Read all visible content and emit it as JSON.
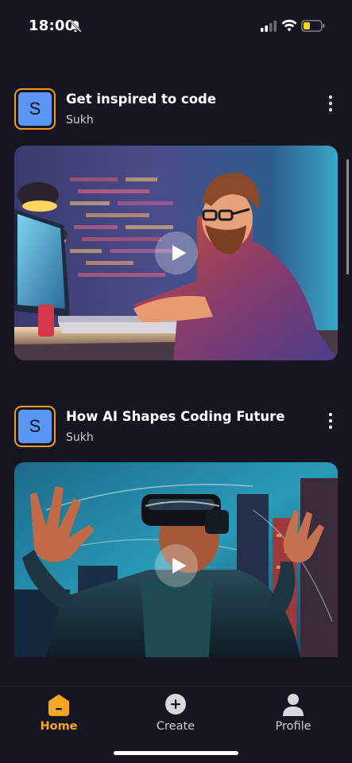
{
  "status_bar": {
    "time": "18:00",
    "icons": [
      "bell-slash-icon",
      "cellular-signal-icon",
      "wifi-icon",
      "battery-icon"
    ],
    "battery_color": "#f5d90a"
  },
  "posts": [
    {
      "avatar_letter": "S",
      "title": "Get inspired to code",
      "author": "Sukh",
      "thumbnail": "developer-at-laptop-illustration"
    },
    {
      "avatar_letter": "S",
      "title": "How AI Shapes Coding Future",
      "author": "Sukh",
      "thumbnail": "vr-headset-city-illustration"
    }
  ],
  "tabs": [
    {
      "label": "Home",
      "icon": "home-icon",
      "active": true
    },
    {
      "label": "Create",
      "icon": "plus-circle-icon",
      "active": false
    },
    {
      "label": "Profile",
      "icon": "user-icon",
      "active": false
    }
  ],
  "colors": {
    "background": "#161622",
    "accent": "#f5a623",
    "avatar_fill": "#5a96f5"
  }
}
